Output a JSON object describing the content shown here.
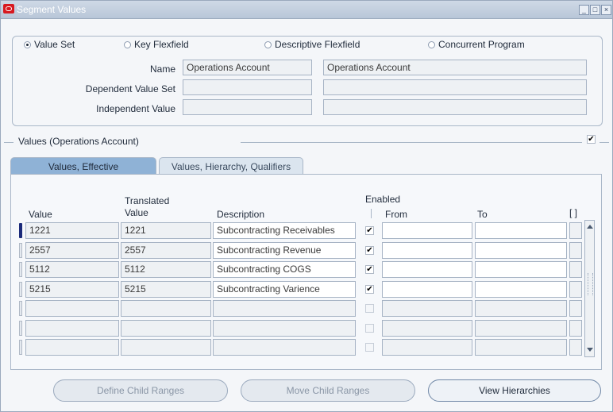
{
  "window": {
    "title": "Segment Values"
  },
  "source": {
    "options": [
      {
        "label": "Value Set",
        "selected": true
      },
      {
        "label": "Key Flexfield",
        "selected": false
      },
      {
        "label": "Descriptive Flexfield",
        "selected": false
      },
      {
        "label": "Concurrent Program",
        "selected": false
      }
    ],
    "name_label": "Name",
    "name_value": "Operations Account",
    "name_desc": "Operations Account",
    "dependent_label": "Dependent Value Set",
    "dependent_value": "",
    "dependent_desc": "",
    "independent_label": "Independent Value",
    "independent_value": "",
    "independent_desc": ""
  },
  "values_section": {
    "title": "Values (Operations Account)",
    "checked": true
  },
  "tabs": [
    {
      "label": "Values, Effective",
      "active": true
    },
    {
      "label": "Values, Hierarchy, Qualifiers",
      "active": false
    }
  ],
  "table": {
    "col_value": "Value",
    "col_translated_1": "Translated",
    "col_translated_2": "Value",
    "col_description": "Description",
    "col_enabled": "Enabled",
    "col_from": "From",
    "col_to": "To",
    "col_flex": "[ ]",
    "rows": [
      {
        "value": "1221",
        "translated": "1221",
        "description": "Subcontracting Receivables",
        "enabled": true
      },
      {
        "value": "2557",
        "translated": "2557",
        "description": "Subcontracting Revenue",
        "enabled": true
      },
      {
        "value": "5112",
        "translated": "5112",
        "description": "Subcontracting COGS",
        "enabled": true
      },
      {
        "value": "5215",
        "translated": "5215",
        "description": "Subcontracting Varience",
        "enabled": true
      },
      {
        "value": "",
        "translated": "",
        "description": "",
        "enabled": false
      },
      {
        "value": "",
        "translated": "",
        "description": "",
        "enabled": false
      },
      {
        "value": "",
        "translated": "",
        "description": "",
        "enabled": false
      }
    ]
  },
  "buttons": {
    "define_child_ranges": "Define Child Ranges",
    "move_child_ranges": "Move Child Ranges",
    "view_hierarchies": "View Hierarchies"
  },
  "colors": {
    "accent": "#8fb2d6",
    "oracle_red": "#d71920"
  }
}
